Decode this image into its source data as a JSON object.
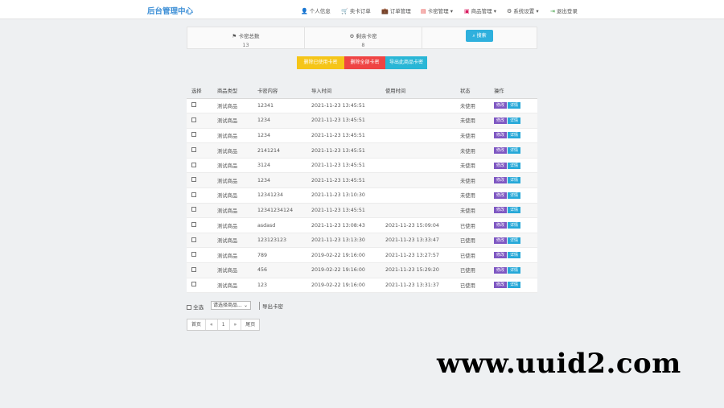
{
  "brand": "后台管理中心",
  "nav": {
    "items": [
      {
        "label": "个人信息",
        "icon": "user-icon",
        "color": "#1e88e5"
      },
      {
        "label": "卖卡订单",
        "icon": "cart-icon",
        "color": "#e53935"
      },
      {
        "label": "订单管理",
        "icon": "briefcase-icon",
        "color": "#e65100"
      },
      {
        "label": "卡密管理 ▾",
        "icon": "card-icon",
        "color": "#e53935"
      },
      {
        "label": "商品管理 ▾",
        "icon": "file-icon",
        "color": "#d81b60"
      },
      {
        "label": "系统设置 ▾",
        "icon": "gear-icon",
        "color": "#555555"
      },
      {
        "label": "退出登录",
        "icon": "logout-icon",
        "color": "#43a047"
      }
    ]
  },
  "stats": {
    "total_label": "卡密总数",
    "total_value": "13",
    "remain_label": "剩余卡密",
    "remain_value": "8",
    "search_label": "搜索"
  },
  "actions": {
    "delete_used": "删除已使用卡密",
    "delete_all": "删除全部卡密",
    "export_all": "导出此商品卡密"
  },
  "table": {
    "headers": [
      "选择",
      "商品类型",
      "卡密内容",
      "导入时间",
      "使用时间",
      "状态",
      "操作"
    ],
    "edit_label": "修改",
    "detail_label": "详情",
    "rows": [
      {
        "type": "测试商品",
        "card": "12341",
        "import": "2021-11-23 13:45:51",
        "used": "",
        "status": "未使用",
        "used_flag": false
      },
      {
        "type": "测试商品",
        "card": "1234",
        "import": "2021-11-23 13:45:51",
        "used": "",
        "status": "未使用",
        "used_flag": false
      },
      {
        "type": "测试商品",
        "card": "1234",
        "import": "2021-11-23 13:45:51",
        "used": "",
        "status": "未使用",
        "used_flag": false
      },
      {
        "type": "测试商品",
        "card": "2141214",
        "import": "2021-11-23 13:45:51",
        "used": "",
        "status": "未使用",
        "used_flag": false
      },
      {
        "type": "测试商品",
        "card": "3124",
        "import": "2021-11-23 13:45:51",
        "used": "",
        "status": "未使用",
        "used_flag": false
      },
      {
        "type": "测试商品",
        "card": "1234",
        "import": "2021-11-23 13:45:51",
        "used": "",
        "status": "未使用",
        "used_flag": false
      },
      {
        "type": "测试商品",
        "card": "12341234",
        "import": "2021-11-23 13:10:30",
        "used": "",
        "status": "未使用",
        "used_flag": false
      },
      {
        "type": "测试商品",
        "card": "12341234124",
        "import": "2021-11-23 13:45:51",
        "used": "",
        "status": "未使用",
        "used_flag": false
      },
      {
        "type": "测试商品",
        "card": "asdasd",
        "import": "2021-11-23 13:08:43",
        "used": "2021-11-23 15:09:04",
        "status": "已使用",
        "used_flag": true
      },
      {
        "type": "测试商品",
        "card": "123123123",
        "import": "2021-11-23 13:13:30",
        "used": "2021-11-23 13:33:47",
        "status": "已使用",
        "used_flag": true
      },
      {
        "type": "测试商品",
        "card": "789",
        "import": "2019-02-22 19:16:00",
        "used": "2021-11-23 13:27:57",
        "status": "已使用",
        "used_flag": true
      },
      {
        "type": "测试商品",
        "card": "456",
        "import": "2019-02-22 19:16:00",
        "used": "2021-11-23 15:29:20",
        "status": "已使用",
        "used_flag": true
      },
      {
        "type": "测试商品",
        "card": "123",
        "import": "2019-02-22 19:16:00",
        "used": "2021-11-23 13:31:37",
        "status": "已使用",
        "used_flag": true
      }
    ]
  },
  "footer": {
    "select_all": "全选",
    "goods_select_value": "请选择商品...",
    "export_label": "导出卡密"
  },
  "pagination": {
    "first": "首页",
    "prev": "«",
    "current": "1",
    "next": "»",
    "last": "尾页"
  },
  "watermark": "www.uuid2.com",
  "colors": {
    "brand": "#3d8fd6",
    "btn_yellow": "#f5c518",
    "btn_red": "#ef4444",
    "btn_cyan": "#29b6d6",
    "search": "#2fb0dd"
  }
}
